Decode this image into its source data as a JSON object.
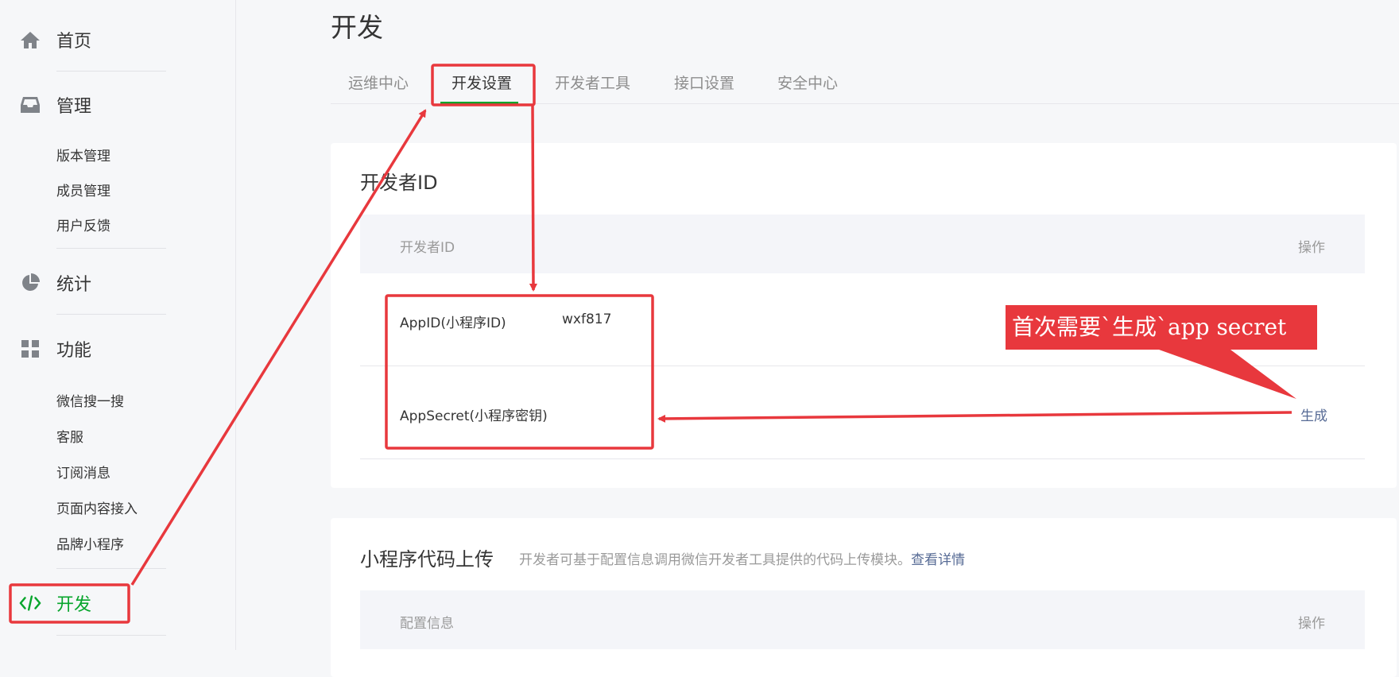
{
  "sidebar": {
    "home": {
      "label": "首页",
      "icon": "home-icon"
    },
    "manage": {
      "label": "管理",
      "icon": "inbox-icon",
      "items": [
        {
          "label": "版本管理"
        },
        {
          "label": "成员管理"
        },
        {
          "label": "用户反馈"
        }
      ]
    },
    "stats": {
      "label": "统计",
      "icon": "pie-chart-icon"
    },
    "features": {
      "label": "功能",
      "icon": "grid-icon",
      "items": [
        {
          "label": "微信搜一搜"
        },
        {
          "label": "客服"
        },
        {
          "label": "订阅消息"
        },
        {
          "label": "页面内容接入"
        },
        {
          "label": "品牌小程序"
        }
      ]
    },
    "dev": {
      "label": "开发",
      "icon": "code-icon"
    }
  },
  "page": {
    "title": "开发",
    "tabs": [
      {
        "label": "运维中心"
      },
      {
        "label": "开发设置"
      },
      {
        "label": "开发者工具"
      },
      {
        "label": "接口设置"
      },
      {
        "label": "安全中心"
      }
    ],
    "active_tab": "开发设置"
  },
  "dev_id_card": {
    "title": "开发者ID",
    "columns": {
      "id": "开发者ID",
      "action": "操作"
    },
    "rows": [
      {
        "label": "AppID(小程序ID)",
        "value": "wxf817",
        "action": ""
      },
      {
        "label": "AppSecret(小程序密钥)",
        "value": "",
        "action": "生成"
      }
    ]
  },
  "upload_card": {
    "title": "小程序代码上传",
    "description": "开发者可基于配置信息调用微信开发者工具提供的代码上传模块。",
    "link": "查看详情",
    "columns": {
      "config": "配置信息",
      "action": "操作"
    }
  },
  "annotation": {
    "callout": "首次需要`生成`app secret",
    "color": "#e8383d"
  },
  "colors": {
    "accent_green": "#07a52c",
    "link_blue": "#576b95",
    "annotation_red": "#e8383d"
  }
}
